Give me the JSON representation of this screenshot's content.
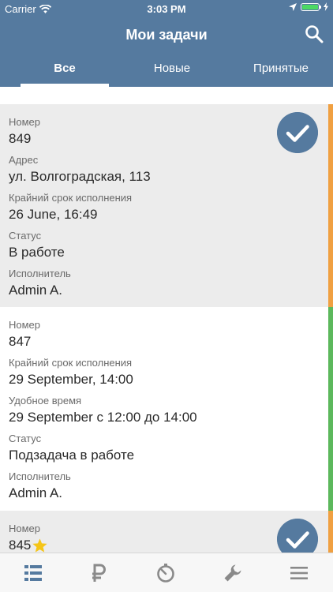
{
  "status_bar": {
    "carrier": "Carrier",
    "time": "3:03 PM"
  },
  "nav": {
    "title": "Мои задачи"
  },
  "tabs": [
    {
      "label": "Все",
      "active": true
    },
    {
      "label": "Новые",
      "active": false
    },
    {
      "label": "Принятые",
      "active": false
    }
  ],
  "tasks": [
    {
      "fields": [
        {
          "label": "Номер",
          "value": "849"
        },
        {
          "label": "Адрес",
          "value": "ул. Волгоградская, 113"
        },
        {
          "label": "Крайний срок исполнения",
          "value": "26 June, 16:49"
        },
        {
          "label": "Статус",
          "value": "В работе"
        },
        {
          "label": "Исполнитель",
          "value": "Admin A."
        }
      ],
      "accepted": true,
      "status_color": "#f0a041",
      "background": "#ececec"
    },
    {
      "fields": [
        {
          "label": "Номер",
          "value": "847"
        },
        {
          "label": "Крайний срок исполнения",
          "value": "29 September, 14:00"
        },
        {
          "label": "Удобное время",
          "value": "29 September с 12:00 до 14:00"
        },
        {
          "label": "Статус",
          "value": "Подзадача в работе"
        },
        {
          "label": "Исполнитель",
          "value": "Admin A."
        }
      ],
      "accepted": false,
      "status_color": "#5cb85c",
      "background": "#ffffff"
    },
    {
      "fields": [
        {
          "label": "Номер",
          "value": "845"
        }
      ],
      "starred": true,
      "accepted": true,
      "status_color": "#f0a041",
      "background": "#ececec"
    }
  ],
  "tab_bar": [
    {
      "icon": "list-icon",
      "active": true
    },
    {
      "icon": "ruble-icon",
      "active": false
    },
    {
      "icon": "timer-icon",
      "active": false
    },
    {
      "icon": "wrench-icon",
      "active": false
    },
    {
      "icon": "menu-icon",
      "active": false
    }
  ],
  "colors": {
    "primary": "#557a9f",
    "accent_orange": "#f0a041",
    "accent_green": "#5cb85c",
    "star": "#f5c518"
  }
}
